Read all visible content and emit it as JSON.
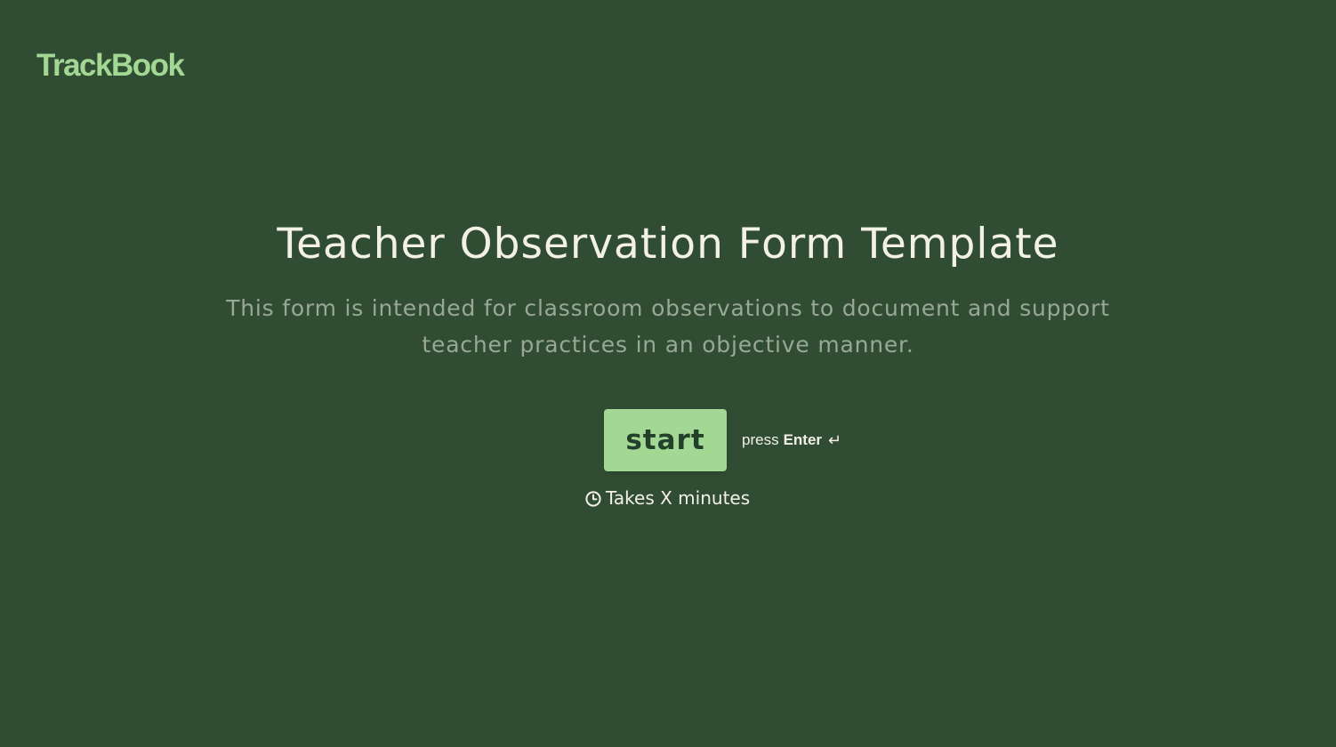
{
  "brand": {
    "logo_text": "TrackBook"
  },
  "welcome": {
    "title": "Teacher Observation Form Template",
    "description": "This form is intended for classroom observations to document and support teacher practices in an objective manner."
  },
  "actions": {
    "start_label": "start",
    "press_prefix": "press",
    "press_key": "Enter",
    "enter_icon": "↵"
  },
  "duration": {
    "icon": "clock-icon",
    "text": "Takes X minutes"
  },
  "colors": {
    "background": "#304d33",
    "accent": "#a3d894",
    "title_text": "#f3f1e6",
    "muted_text": "#97a894"
  }
}
